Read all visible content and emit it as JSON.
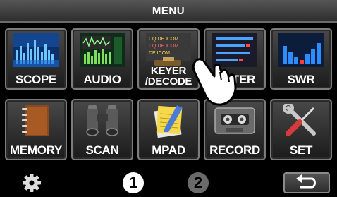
{
  "header": {
    "title": "MENU"
  },
  "tiles": [
    {
      "label": "SCOPE",
      "icon": "scope-icon"
    },
    {
      "label": "AUDIO",
      "icon": "audio-icon"
    },
    {
      "label": "KEYER\n/DECODE",
      "icon": "keyer-decode-icon",
      "icon_text": [
        "CQ DE ICOM",
        "CQ DE ICOM",
        "DE ICOM"
      ]
    },
    {
      "label": "METER",
      "icon": "meter-icon"
    },
    {
      "label": "SWR",
      "icon": "swr-icon"
    },
    {
      "label": "MEMORY",
      "icon": "memory-book-icon"
    },
    {
      "label": "SCAN",
      "icon": "binoculars-icon"
    },
    {
      "label": "MPAD",
      "icon": "memo-pad-icon"
    },
    {
      "label": "RECORD",
      "icon": "cassette-icon"
    },
    {
      "label": "SET",
      "icon": "wrench-screwdriver-icon"
    }
  ],
  "footer": {
    "settings_icon": "gear-icon",
    "pages": [
      "1",
      "2"
    ],
    "active_page": "1",
    "back_icon": "return-arrow-icon"
  },
  "overlay": {
    "icon": "pointing-hand-icon"
  }
}
